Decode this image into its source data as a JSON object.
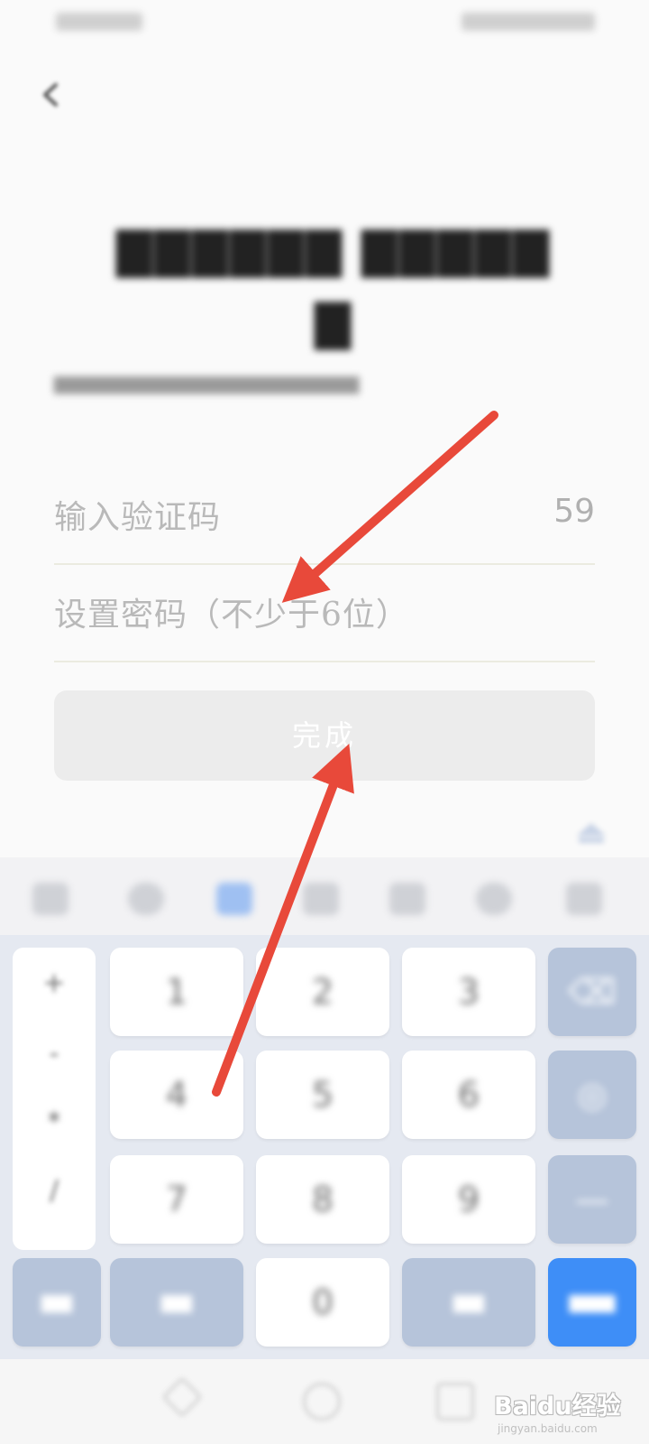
{
  "form": {
    "code_placeholder": "输入验证码",
    "countdown": "59",
    "password_placeholder": "设置密码（不少于6位）",
    "done_label": "完成"
  },
  "keyboard": {
    "digits": [
      "1",
      "2",
      "3",
      "4",
      "5",
      "6",
      "7",
      "8",
      "9",
      "0"
    ],
    "symbols": [
      "+",
      "-",
      "*",
      "/"
    ]
  },
  "watermark": {
    "logo": "Baidu经验",
    "url": "jingyan.baidu.com"
  },
  "colors": {
    "annotation_arrow": "#e8493a",
    "next_key": "#3e8ef7",
    "function_key": "#b6c4da"
  },
  "icons": {
    "back": "chevron-left-icon",
    "collapse_keyboard": "keyboard-collapse-icon"
  }
}
